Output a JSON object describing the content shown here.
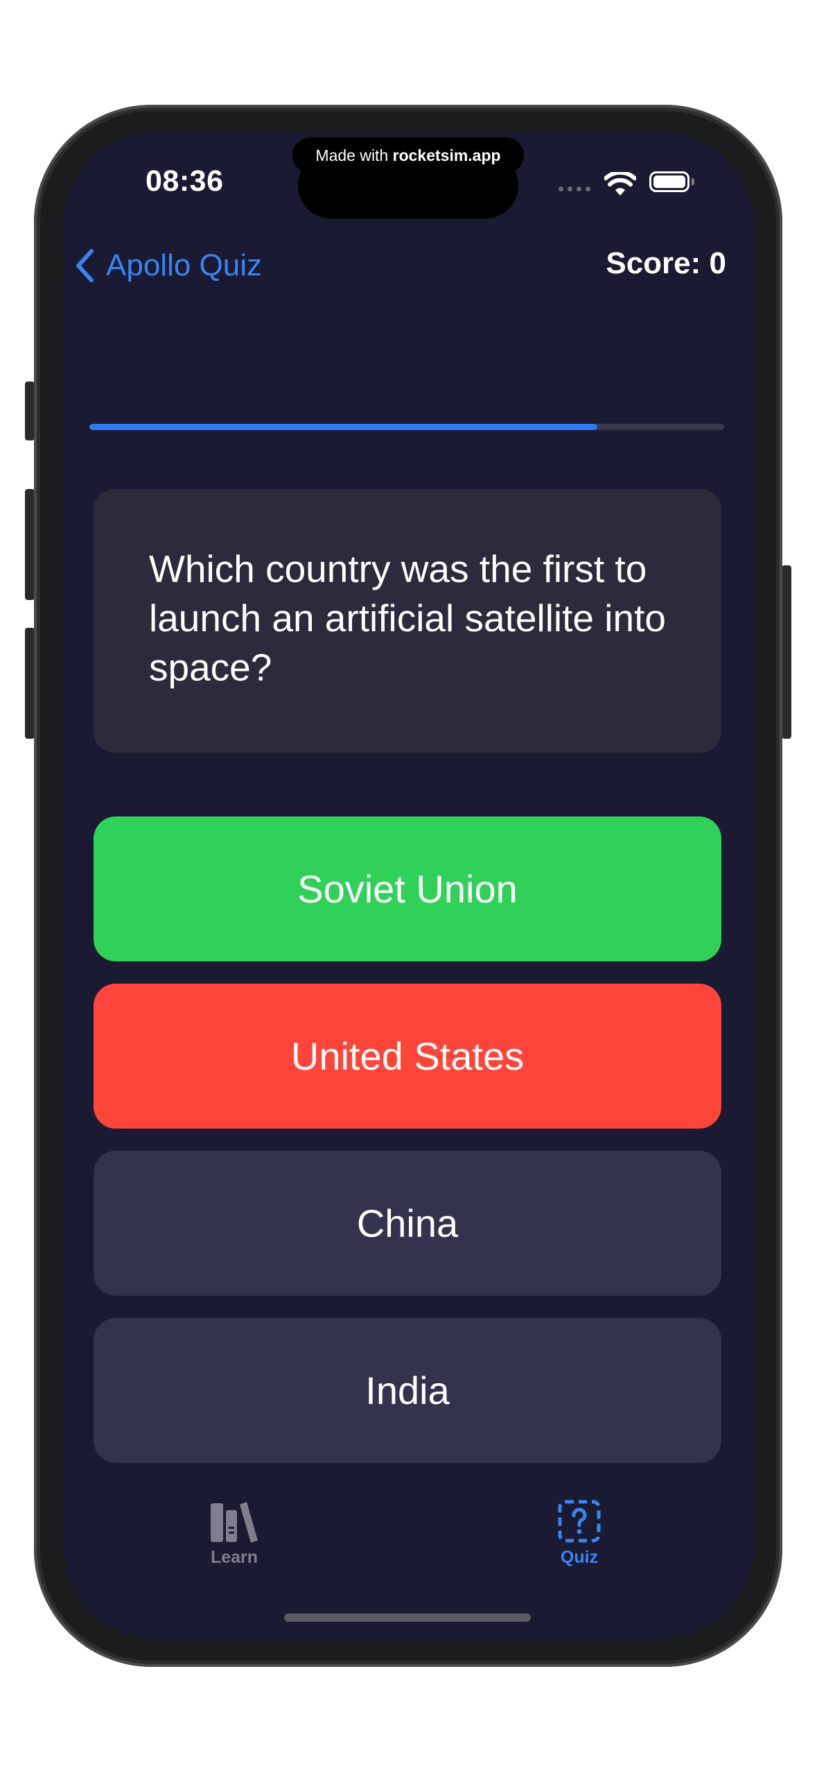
{
  "watermark": {
    "prefix": "Made with ",
    "brand": "rocketsim.app"
  },
  "status_bar": {
    "time": "08:36"
  },
  "nav": {
    "back_label": "Apollo Quiz",
    "score_text": "Score: 0"
  },
  "progress": {
    "fraction": 0.8
  },
  "question": {
    "text": "Which country was the first to launch an artificial satellite into space?"
  },
  "answers": [
    {
      "label": "Soviet Union",
      "state": "correct",
      "color": "#30d158"
    },
    {
      "label": "United States",
      "state": "incorrect",
      "color": "#ff453a"
    },
    {
      "label": "China",
      "state": "neutral",
      "color": "#33334e"
    },
    {
      "label": "India",
      "state": "neutral",
      "color": "#33334e"
    }
  ],
  "tab_bar": {
    "items": [
      {
        "label": "Learn",
        "icon": "books-icon",
        "selected": false
      },
      {
        "label": "Quiz",
        "icon": "questionmark-dashed-square-icon",
        "selected": true
      }
    ]
  },
  "colors": {
    "background": "#1a1a32",
    "accent": "#3a84f5",
    "card": "#2b2b3b",
    "tab_inactive": "#7e7e8e"
  }
}
